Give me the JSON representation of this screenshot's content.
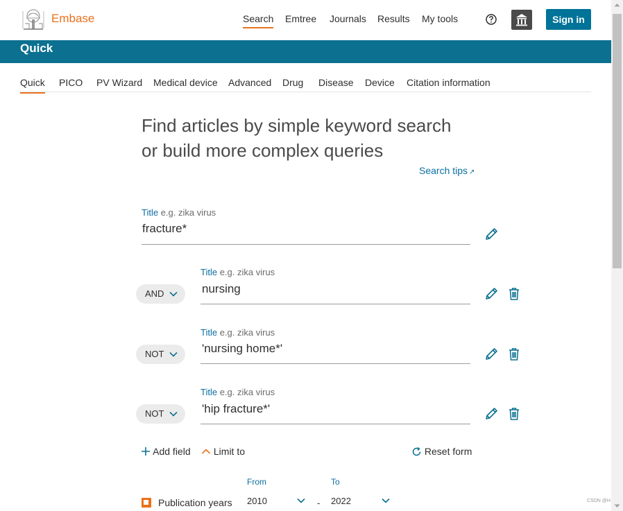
{
  "header": {
    "logo_text": "Embase",
    "nav": [
      "Search",
      "Emtree",
      "Journals",
      "Results",
      "My tools"
    ],
    "active_nav": "Search",
    "sign_in": "Sign in",
    "help_icon": "help-circle-icon",
    "institution_icon": "institution-icon"
  },
  "banner": {
    "title": "Quick"
  },
  "tabs": [
    "Quick",
    "PICO",
    "PV Wizard",
    "Medical device",
    "Advanced",
    "Drug",
    "Disease",
    "Device",
    "Citation information"
  ],
  "active_tab": "Quick",
  "heading": {
    "line1": "Find articles by simple keyword search",
    "line2": "or build more complex queries"
  },
  "search_tips": "Search tips",
  "query_rows": [
    {
      "operator": "",
      "field": "Title",
      "placeholder": "e.g. zika virus",
      "value": "fracture*"
    },
    {
      "operator": "AND",
      "field": "Title",
      "placeholder": "e.g. zika virus",
      "value": "nursing"
    },
    {
      "operator": "NOT",
      "field": "Title",
      "placeholder": "e.g. zika virus",
      "value": "'nursing home*'"
    },
    {
      "operator": "NOT",
      "field": "Title",
      "placeholder": "e.g. zika virus",
      "value": "'hip fracture*'"
    }
  ],
  "actions": {
    "add_field": "Add field",
    "limit_to": "Limit to",
    "reset_form": "Reset form"
  },
  "publication_years": {
    "label": "Publication years",
    "from_label": "From",
    "to_label": "To",
    "from_value": "2010",
    "to_value": "2022",
    "separator": "-",
    "checked": true
  },
  "watermark": "CSDN @H",
  "colors": {
    "accent": "#e9711c",
    "primary": "#007398",
    "banner": "#0c7090",
    "link": "#0b6ea0"
  }
}
